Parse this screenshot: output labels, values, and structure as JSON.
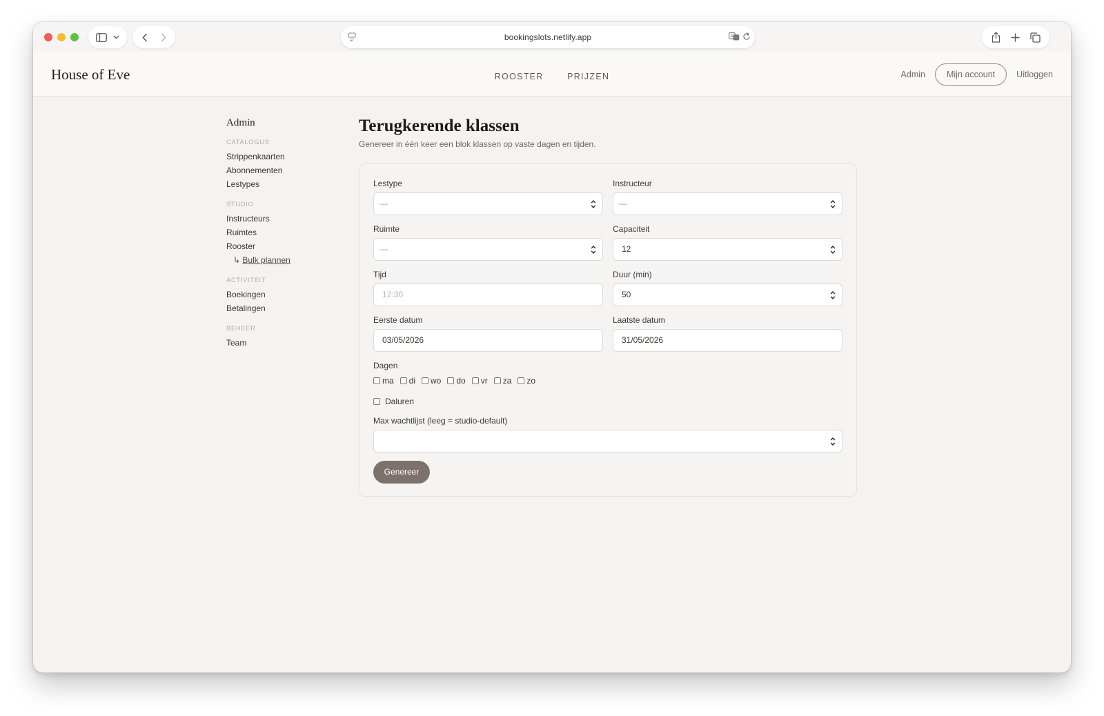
{
  "browser": {
    "url": "bookingslots.netlify.app"
  },
  "site": {
    "brand": "House of Eve",
    "nav": [
      "ROOSTER",
      "PRIJZEN"
    ],
    "admin_link": "Admin",
    "account_button": "Mijn account",
    "logout_link": "Uitloggen"
  },
  "sidebar": {
    "title": "Admin",
    "groups": [
      {
        "heading": "CATALOGUS",
        "items": [
          "Strippenkaarten",
          "Abonnementen",
          "Lestypes"
        ]
      },
      {
        "heading": "STUDIO",
        "items": [
          "Instructeurs",
          "Ruimtes",
          "Rooster"
        ],
        "sub_item": {
          "arrow": "↳",
          "label": "Bulk plannen"
        }
      },
      {
        "heading": "ACTIVITEIT",
        "items": [
          "Boekingen",
          "Betalingen"
        ]
      },
      {
        "heading": "BEHEER",
        "items": [
          "Team"
        ]
      }
    ]
  },
  "page": {
    "title": "Terugkerende klassen",
    "subtitle": "Genereer in één keer een blok klassen op vaste dagen en tijden."
  },
  "form": {
    "lestype": {
      "label": "Lestype",
      "value": "—"
    },
    "instructeur": {
      "label": "Instructeur",
      "value": "—"
    },
    "ruimte": {
      "label": "Ruimte",
      "value": "—"
    },
    "capaciteit": {
      "label": "Capaciteit",
      "value": "12"
    },
    "tijd": {
      "label": "Tijd",
      "placeholder": "12:30"
    },
    "duur": {
      "label": "Duur (min)",
      "value": "50"
    },
    "eerste_datum": {
      "label": "Eerste datum",
      "value": "03/05/2026"
    },
    "laatste_datum": {
      "label": "Laatste datum",
      "value": "31/05/2026"
    },
    "dagen": {
      "label": "Dagen",
      "options": [
        "ma",
        "di",
        "wo",
        "do",
        "vr",
        "za",
        "zo"
      ]
    },
    "daluren": {
      "label": "Daluren"
    },
    "max_wachtlijst": {
      "label": "Max wachtlijst (leeg = studio-default)",
      "value": ""
    },
    "submit": "Genereer"
  }
}
